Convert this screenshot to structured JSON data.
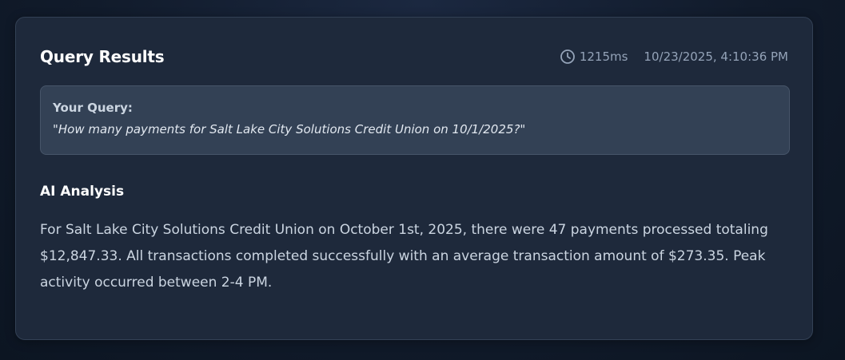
{
  "results": {
    "title": "Query Results",
    "duration": "1215ms",
    "timestamp": "10/23/2025, 4:10:36 PM"
  },
  "query": {
    "label": "Your Query:",
    "text": "\"How many payments for Salt Lake City Solutions Credit Union on 10/1/2025?\""
  },
  "analysis": {
    "title": "AI Analysis",
    "text": "For Salt Lake City Solutions Credit Union on October 1st, 2025, there were 47 payments processed totaling $12,847.33. All transactions completed successfully with an average transaction amount of $273.35. Peak activity occurred between 2-4 PM."
  },
  "icons": {
    "duration_icon": "clock-icon"
  }
}
